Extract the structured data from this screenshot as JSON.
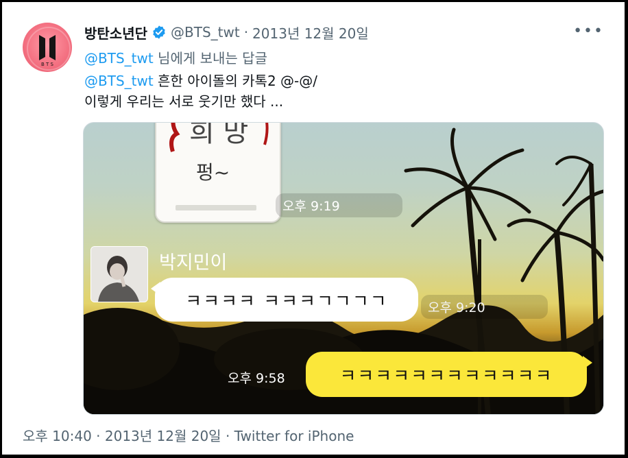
{
  "tweet": {
    "display_name": "방탄소년단",
    "handle": "@BTS_twt",
    "separator": "·",
    "date": "2013년 12월 20일",
    "more_icon": "more-horizontal-icon",
    "reply_mention": "@BTS_twt",
    "reply_suffix": " 님에게 보내는 답글",
    "text_mention": "@BTS_twt",
    "text_line1": "  흔한 아이돌의 카톡2 @-@/",
    "text_line2": "이렇게 우리는 서로 웃기만 했다 ..."
  },
  "media": {
    "time_1": "오후 9:19",
    "sender_name": "박지민이",
    "message_white": "ㅋㅋㅋㅋ ㅋㅋㅋㄱㄱㄱㄱ",
    "time_2": "오후 9:20",
    "time_3": "오후 9:58",
    "message_yellow": "ㅋㅋㅋㅋㅋㅋㅋㅋㅋㅋㅋㅋ"
  },
  "footer": {
    "time": "오후 10:40",
    "date": "2013년 12월 20일",
    "source": "Twitter for iPhone"
  },
  "colors": {
    "link": "#1d9bf0",
    "verified": "#1d9bf0",
    "avatar": "#f36f80",
    "kakao_yellow": "#fbe73a"
  }
}
